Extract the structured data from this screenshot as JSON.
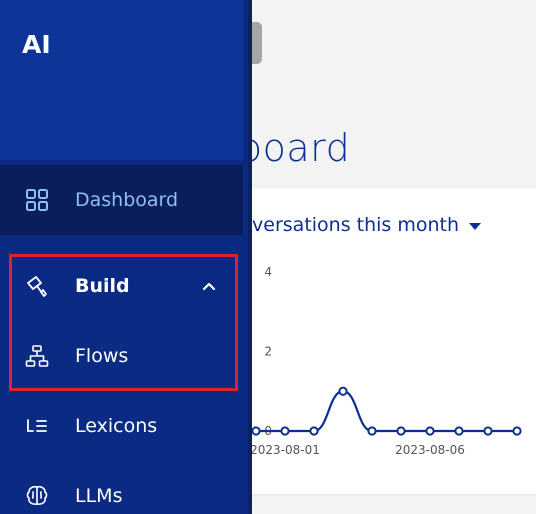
{
  "app": {
    "logo_text": "AI"
  },
  "sidebar": {
    "items": [
      {
        "id": "dashboard",
        "label": "Dashboard",
        "icon": "grid-icon",
        "active": true
      },
      {
        "id": "build",
        "label": "Build",
        "icon": "paint-roller-icon",
        "expanded": true
      },
      {
        "id": "flows",
        "label": "Flows",
        "icon": "flow-diagram-icon"
      },
      {
        "id": "lexicons",
        "label": "Lexicons",
        "icon": "text-list-icon"
      },
      {
        "id": "llms",
        "label": "LLMs",
        "icon": "brain-icon"
      }
    ]
  },
  "main": {
    "page_title": "board",
    "metric_select": "nversations this month"
  },
  "colors": {
    "sidebar_bg": "#0a2a84",
    "sidebar_header_bg": "#0d3499",
    "active_item_bg": "#0b1e5c",
    "active_label": "#8fbdf6",
    "accent": "#0d2f8f",
    "highlight": "#e02030"
  },
  "chart_data": {
    "type": "line",
    "x": [
      "2023-07-31",
      "2023-08-01",
      "2023-08-02",
      "2023-08-03",
      "2023-08-04",
      "2023-08-05",
      "2023-08-06",
      "2023-08-07",
      "2023-08-08",
      "2023-08-09"
    ],
    "values": [
      0,
      0,
      0,
      1,
      0,
      0,
      0,
      0,
      0,
      0
    ],
    "x_tick_labels": [
      "2023-08-01",
      "2023-08-06"
    ],
    "y_ticks": [
      0,
      2,
      4
    ],
    "ylim": [
      0,
      4
    ],
    "color": "#0d2f8f",
    "title": "",
    "xlabel": "",
    "ylabel": ""
  }
}
